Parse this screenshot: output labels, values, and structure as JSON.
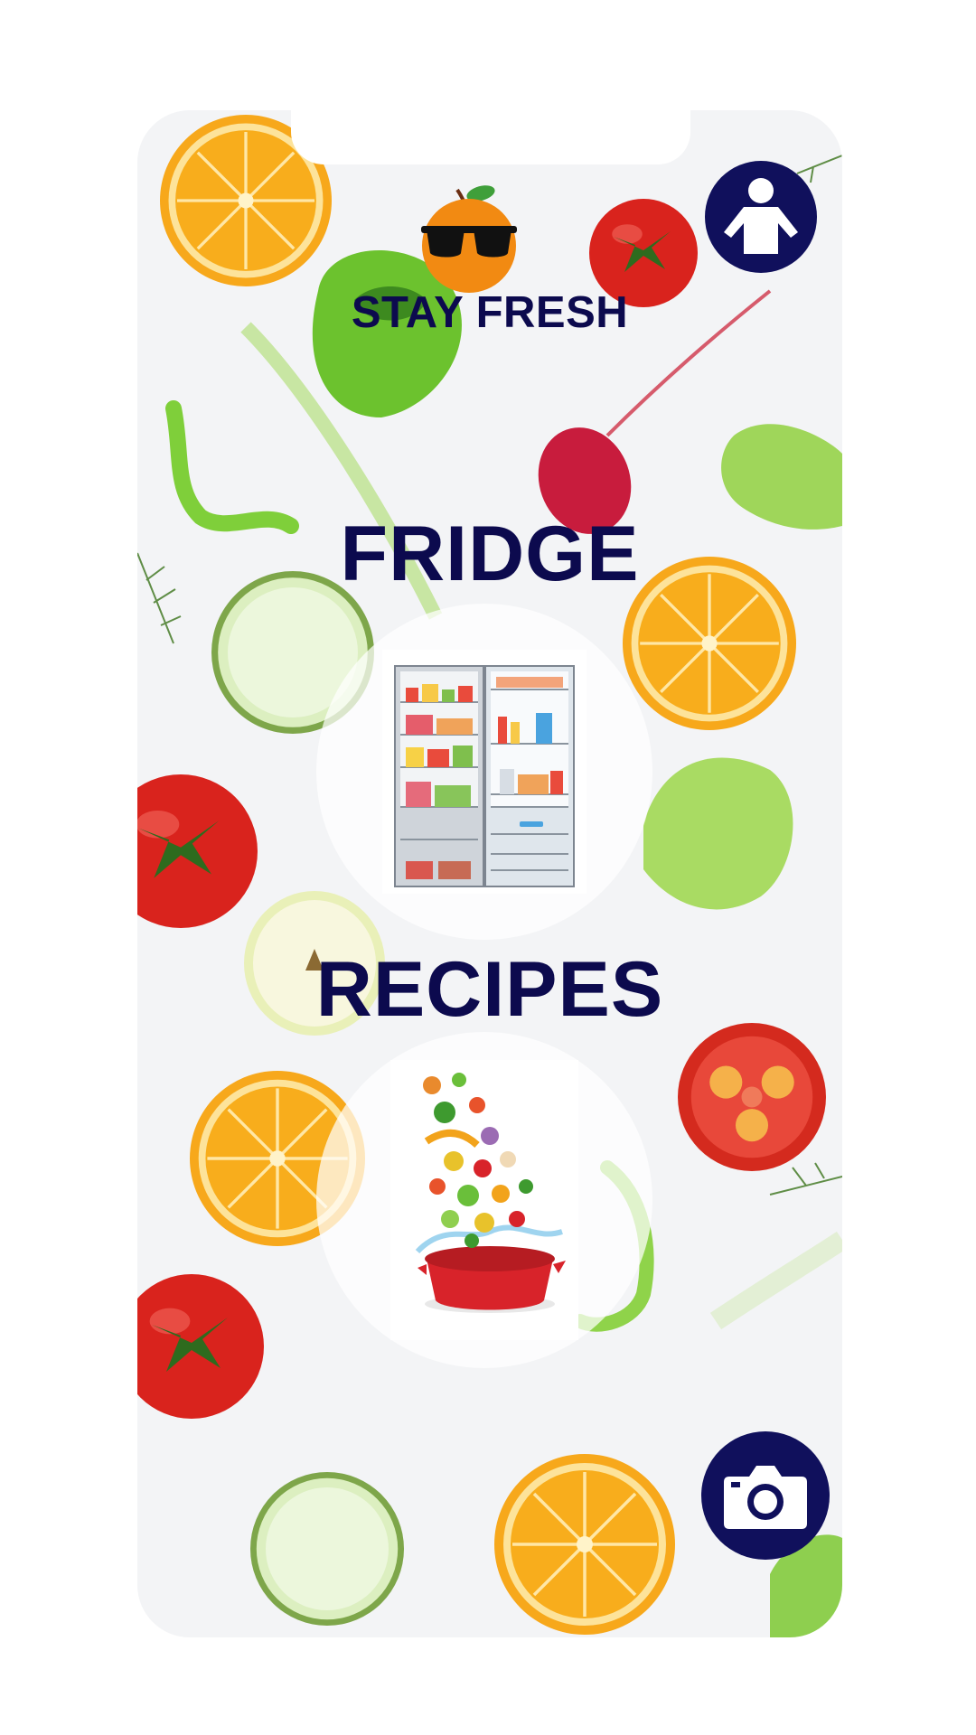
{
  "app": {
    "title": "STAY FRESH",
    "brand_color": "#0c0a4e",
    "button_color": "#10105c"
  },
  "header": {
    "logo_icon": "orange-with-sunglasses",
    "profile_icon": "person-icon"
  },
  "sections": {
    "fridge": {
      "label": "FRIDGE",
      "icon": "open-fridge-illustration"
    },
    "recipes": {
      "label": "RECIPES",
      "icon": "vegetables-falling-into-pot-illustration"
    }
  },
  "footer": {
    "camera_icon": "camera-icon"
  }
}
